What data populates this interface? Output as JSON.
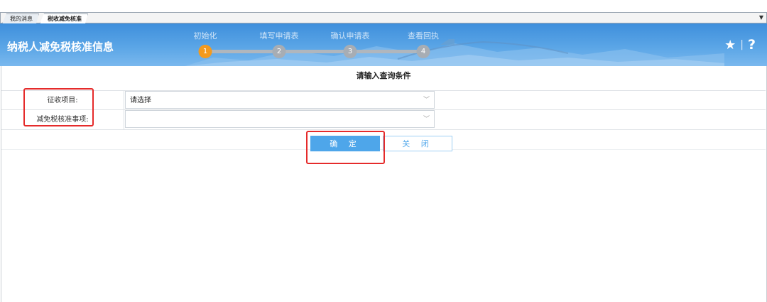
{
  "tabs": [
    {
      "label": "我的消息"
    },
    {
      "label": "税收减免核准"
    }
  ],
  "header": {
    "title": "纳税人减免税核准信息",
    "steps": [
      {
        "label": "初始化",
        "number": "1",
        "active": true
      },
      {
        "label": "填写申请表",
        "number": "2",
        "active": false
      },
      {
        "label": "确认申请表",
        "number": "3",
        "active": false
      },
      {
        "label": "查看回执",
        "number": "4",
        "active": false
      }
    ],
    "icons": [
      "star-icon",
      "help-icon"
    ],
    "separator": "|",
    "help_glyph": "?",
    "star_glyph": "★"
  },
  "form": {
    "title": "请输入查询条件",
    "fields": [
      {
        "label": "征收项目:",
        "value": "请选择"
      },
      {
        "label": "减免税核准事项:",
        "value": ""
      }
    ]
  },
  "buttons": {
    "confirm": "确 定",
    "close": "关 闭"
  },
  "colors": {
    "accent": "#4ea6ea",
    "active_step": "#f39a1e",
    "highlight": "#e52b2b"
  }
}
